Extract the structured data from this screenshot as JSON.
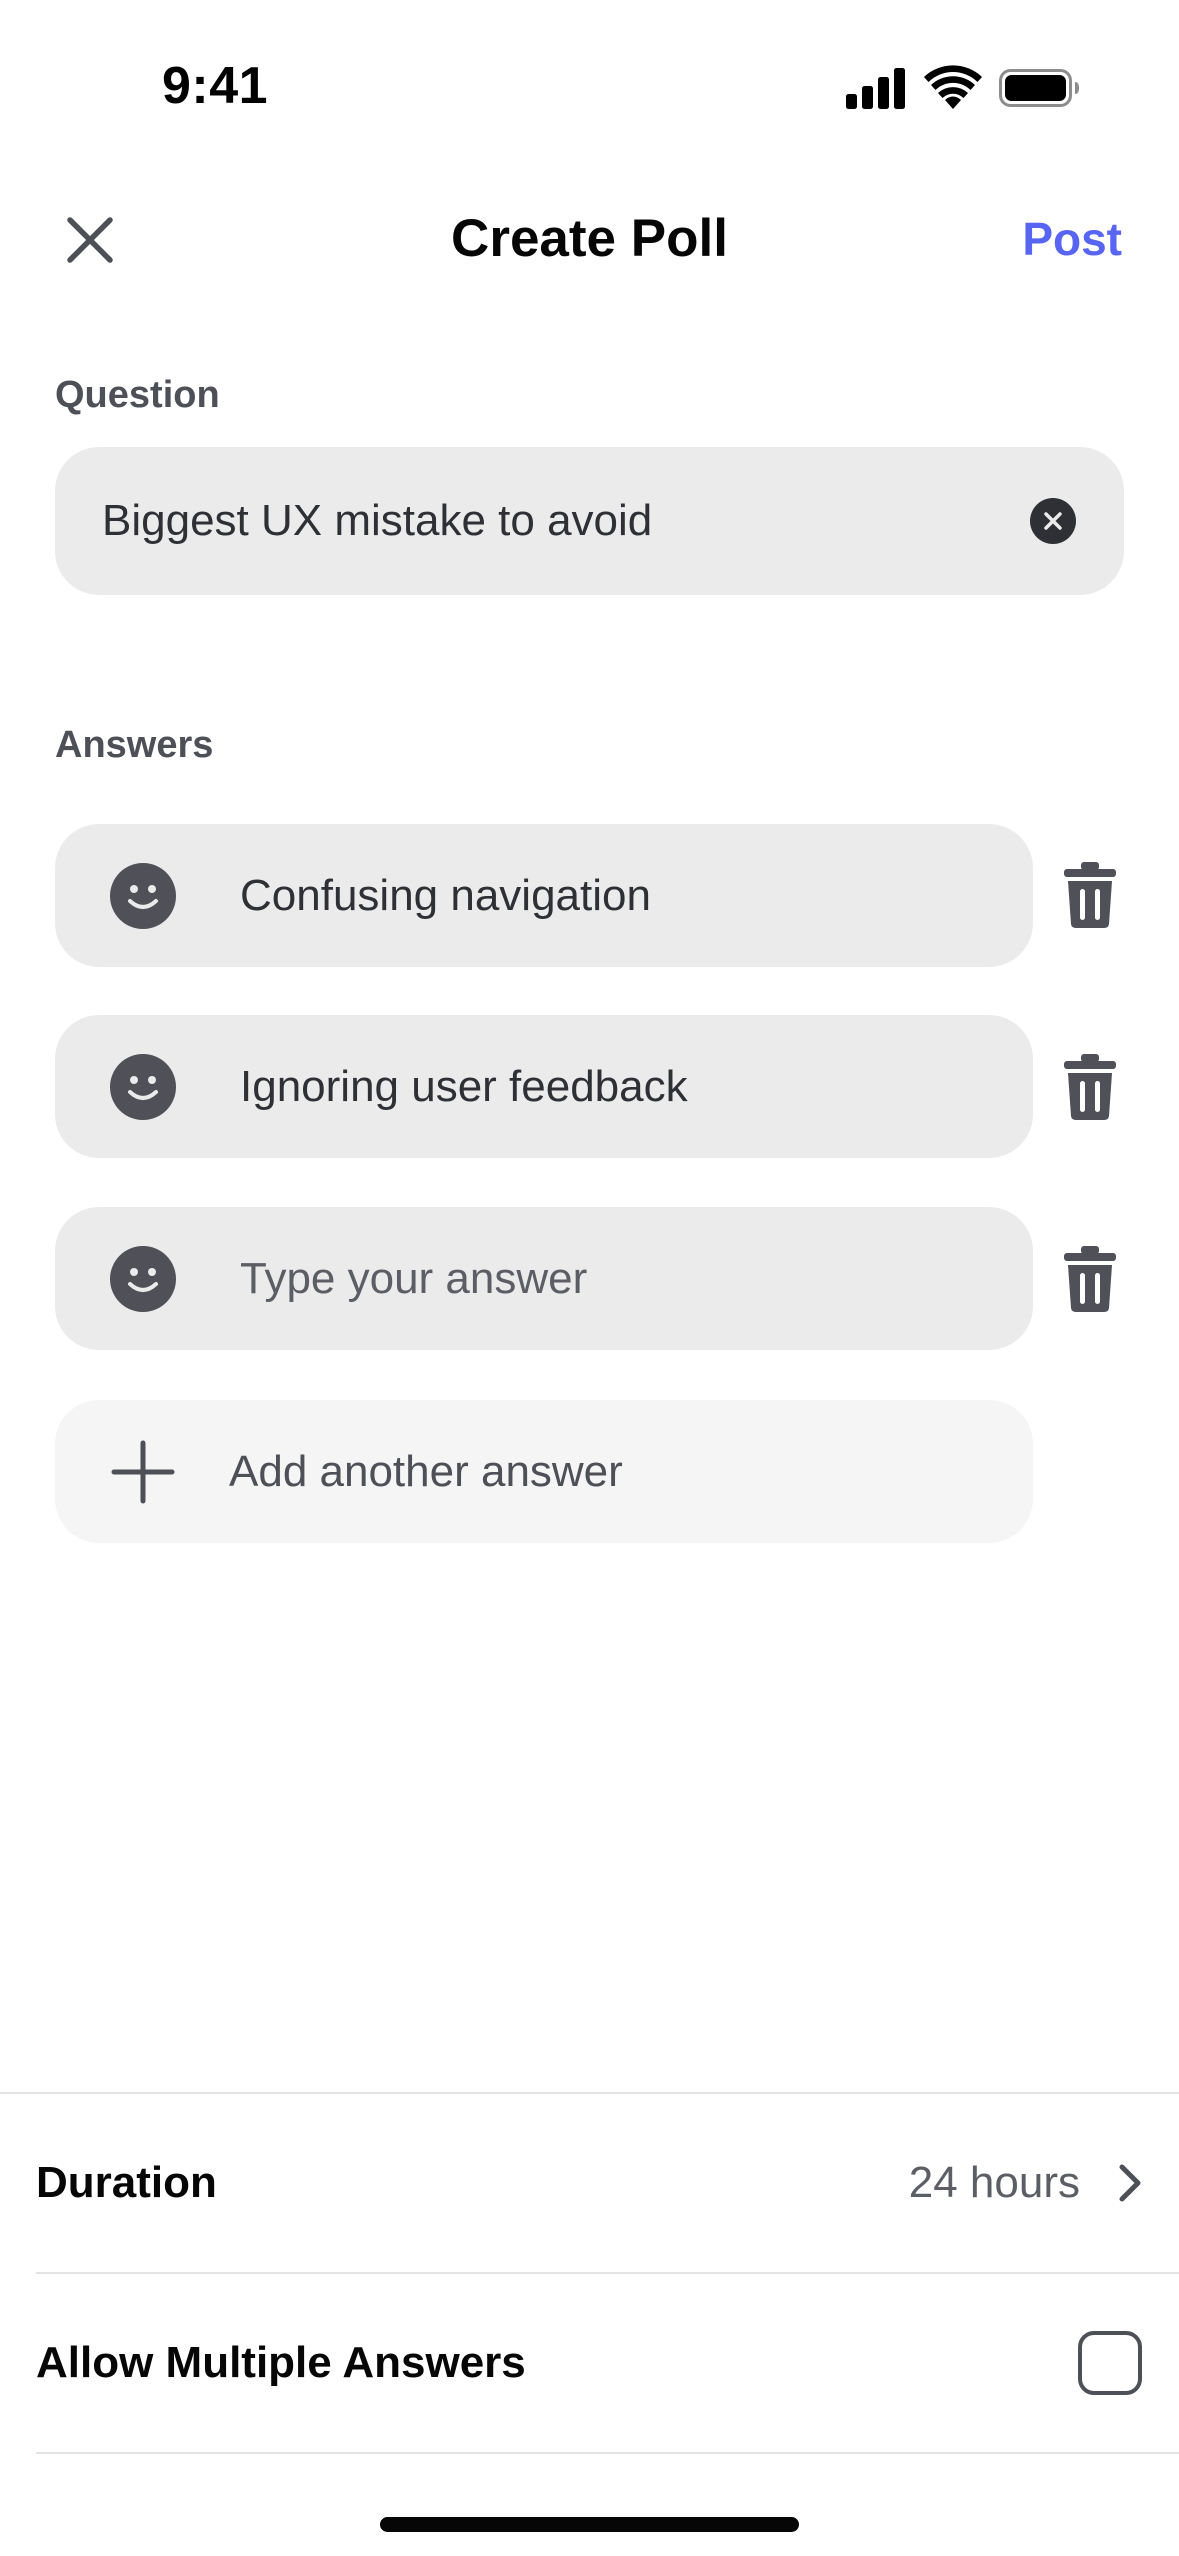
{
  "status_bar": {
    "time": "9:41"
  },
  "header": {
    "title": "Create Poll",
    "post_label": "Post"
  },
  "question": {
    "label": "Question",
    "value": "Biggest UX mistake to avoid"
  },
  "answers": {
    "label": "Answers",
    "items": [
      {
        "text": "Confusing navigation",
        "is_placeholder": false
      },
      {
        "text": "Ignoring user feedback",
        "is_placeholder": false
      },
      {
        "text": "Type your answer",
        "is_placeholder": true
      }
    ],
    "add_label": "Add another answer"
  },
  "settings": {
    "duration_label": "Duration",
    "duration_value": "24 hours",
    "multiple_label": "Allow Multiple Answers",
    "multiple_checked": false
  },
  "colors": {
    "accent": "#5865f2",
    "field_bg": "#ebebeb",
    "icon_dark": "#4f5058"
  }
}
